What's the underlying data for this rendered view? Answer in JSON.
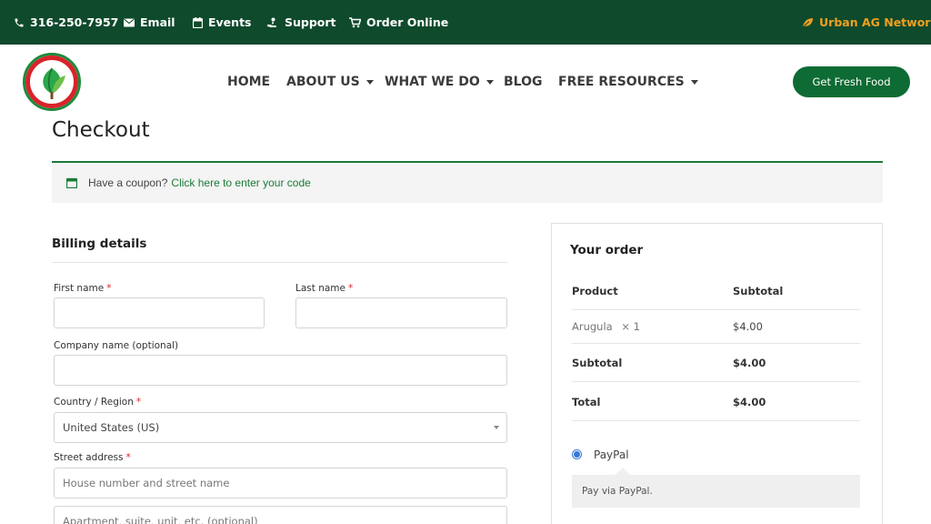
{
  "topbar": {
    "phone": "316-250-7957",
    "email": "Email",
    "events": "Events",
    "support": "Support",
    "order_online": "Order Online",
    "network": "Urban AG Network",
    "background_color": "#0f4a2c",
    "network_color": "#f0a020"
  },
  "header": {
    "logo_alt": "COMMON GROUND",
    "nav": [
      {
        "label": "HOME",
        "dropdown": false
      },
      {
        "label": "ABOUT US",
        "dropdown": true
      },
      {
        "label": "WHAT WE DO",
        "dropdown": true
      },
      {
        "label": "BLOG",
        "dropdown": false
      },
      {
        "label": "FREE RESOURCES",
        "dropdown": true
      }
    ],
    "cta": "Get Fresh Food",
    "cta_color": "#0d6b33"
  },
  "page": {
    "title": "Checkout"
  },
  "coupon": {
    "text": "Have a coupon?",
    "link": "Click here to enter your code",
    "accent_color": "#1d7a3a"
  },
  "billing": {
    "title": "Billing details",
    "first_name": {
      "label": "First name",
      "value": ""
    },
    "last_name": {
      "label": "Last name",
      "value": ""
    },
    "company": {
      "label": "Company name (optional)",
      "value": ""
    },
    "country": {
      "label": "Country / Region",
      "value": "United States (US)"
    },
    "street": {
      "label": "Street address",
      "placeholder_1": "House number and street name",
      "placeholder_2": "Apartment, suite, unit, etc. (optional)"
    },
    "required_marker": "*"
  },
  "order": {
    "title": "Your order",
    "col_product": "Product",
    "col_subtotal": "Subtotal",
    "item_name": "Arugula",
    "item_qty": "× 1",
    "item_price": "$4.00",
    "subtotal_label": "Subtotal",
    "subtotal_value": "$4.00",
    "total_label": "Total",
    "total_value": "$4.00",
    "payment_method": "PayPal",
    "payment_description": "Pay via PayPal."
  }
}
